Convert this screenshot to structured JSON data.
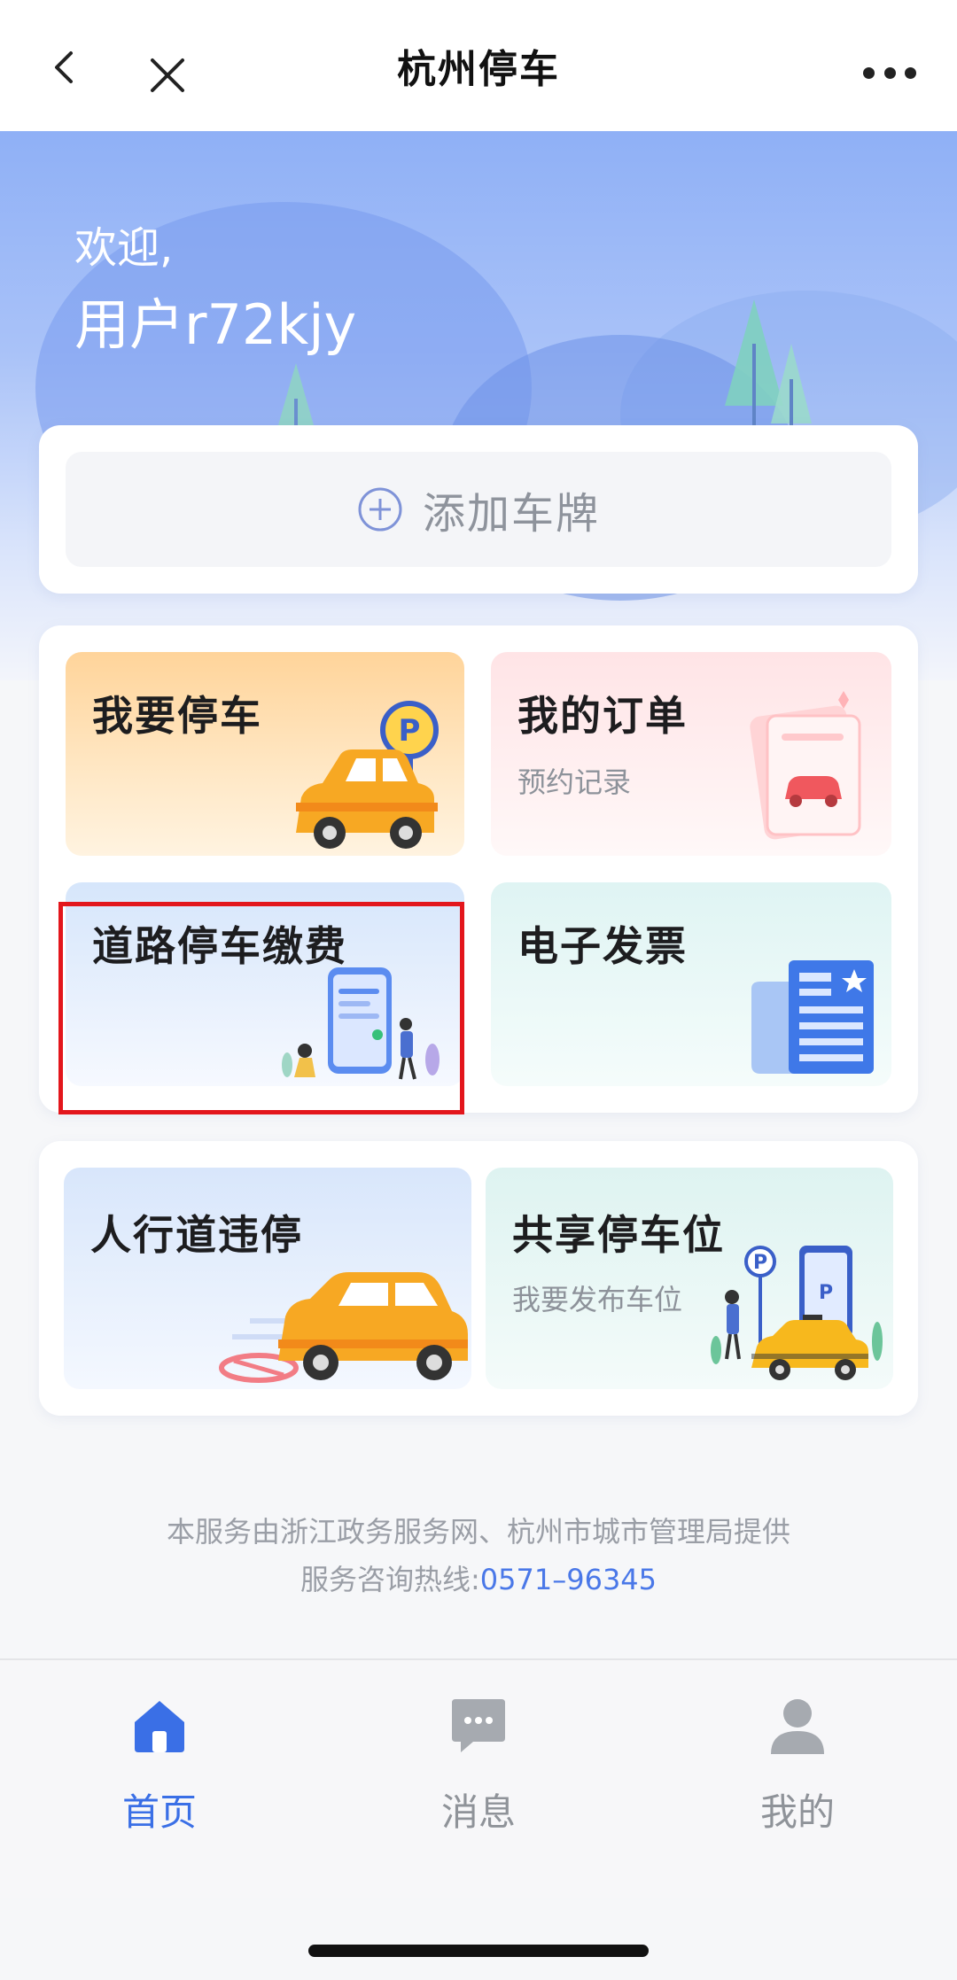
{
  "topbar": {
    "title": "杭州停车"
  },
  "hero": {
    "welcome": "欢迎,",
    "username": "用户r72kjy"
  },
  "plate": {
    "add_label": "添加车牌"
  },
  "services": [
    {
      "title": "我要停车",
      "subtitle": ""
    },
    {
      "title": "我的订单",
      "subtitle": "预约记录"
    },
    {
      "title": "道路停车缴费",
      "subtitle": ""
    },
    {
      "title": "电子发票",
      "subtitle": ""
    },
    {
      "title": "人行道违停",
      "subtitle": ""
    },
    {
      "title": "共享停车位",
      "subtitle": "我要发布车位"
    }
  ],
  "footer": {
    "line1": "本服务由浙江政务服务网、杭州市城市管理局提供",
    "hotline_prefix": "服务咨询热线:",
    "hotline": "0571–96345"
  },
  "tabs": [
    {
      "label": "首页",
      "icon": "home-icon",
      "active": true
    },
    {
      "label": "消息",
      "icon": "message-icon",
      "active": false
    },
    {
      "label": "我的",
      "icon": "user-icon",
      "active": false
    }
  ],
  "colors": {
    "accent": "#3a6fe6",
    "highlight": "#e3161c"
  }
}
